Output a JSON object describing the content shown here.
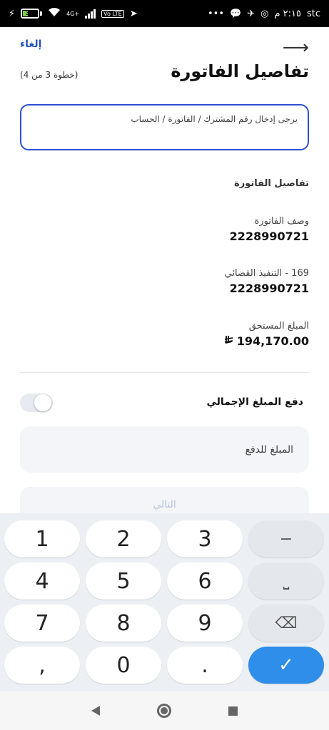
{
  "status_bar": {
    "battery": "31",
    "network_label": "4G+",
    "volte_label": "Vo LTE",
    "right_text": "stc",
    "time": "٢:١٥ م",
    "more_dots": "•••"
  },
  "header": {
    "cancel_label": "إلغاء",
    "title": "تفاصيل الفاتورة",
    "step": "(خطوة 3 من 4)"
  },
  "info_box": {
    "text": "يرجى إدخال رقم المشترك / الفاتورة / الحساب"
  },
  "section": {
    "title": "تفاصيل الفاتورة"
  },
  "fields": [
    {
      "label": "وصف الفاتورة",
      "value": "2228990721"
    },
    {
      "label": "169 - التنفيذ القضائي",
      "value": "2228990721"
    },
    {
      "label": "المبلغ المستحق",
      "value": "194,170.00",
      "currency": "⃁"
    }
  ],
  "toggle": {
    "label": "دفع المبلغ الإجمالي",
    "on": false
  },
  "amount_input": {
    "placeholder": "المبلغ للدفع"
  },
  "next_button": {
    "label": "التالي"
  },
  "keyboard": {
    "keys": [
      "1",
      "2",
      "3",
      "−",
      "4",
      "5",
      "6",
      "⎵",
      "7",
      "8",
      "9",
      "⌫",
      ",",
      "0",
      ".",
      "✓"
    ]
  }
}
